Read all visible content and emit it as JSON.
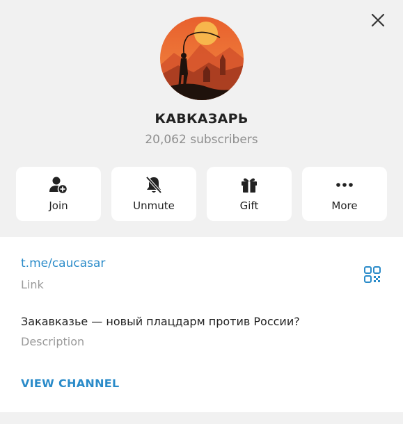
{
  "window": {
    "close_icon": "close-icon"
  },
  "channel": {
    "name": "КАВКАЗАРЬ",
    "subscribers": "20,062 subscribers",
    "avatar_colors": {
      "sun": "#f5b24a",
      "sky": "#e8602d",
      "silhouette": "#1f120c"
    }
  },
  "actions": [
    {
      "label": "Join",
      "icon": "add-user-icon"
    },
    {
      "label": "Unmute",
      "icon": "bell-off-icon"
    },
    {
      "label": "Gift",
      "icon": "gift-icon"
    },
    {
      "label": "More",
      "icon": "more-dots-icon"
    }
  ],
  "info": {
    "link_value": "t.me/caucasar",
    "link_caption": "Link",
    "qr_icon": "qr-code-icon",
    "description_value": "Закавказье — новый плацдарм против России?",
    "description_caption": "Description",
    "view_channel": "VIEW CHANNEL"
  },
  "colors": {
    "accent": "#2a8bc9",
    "background": "#f1f1f1",
    "card": "#ffffff",
    "muted": "#9a9a9a"
  }
}
